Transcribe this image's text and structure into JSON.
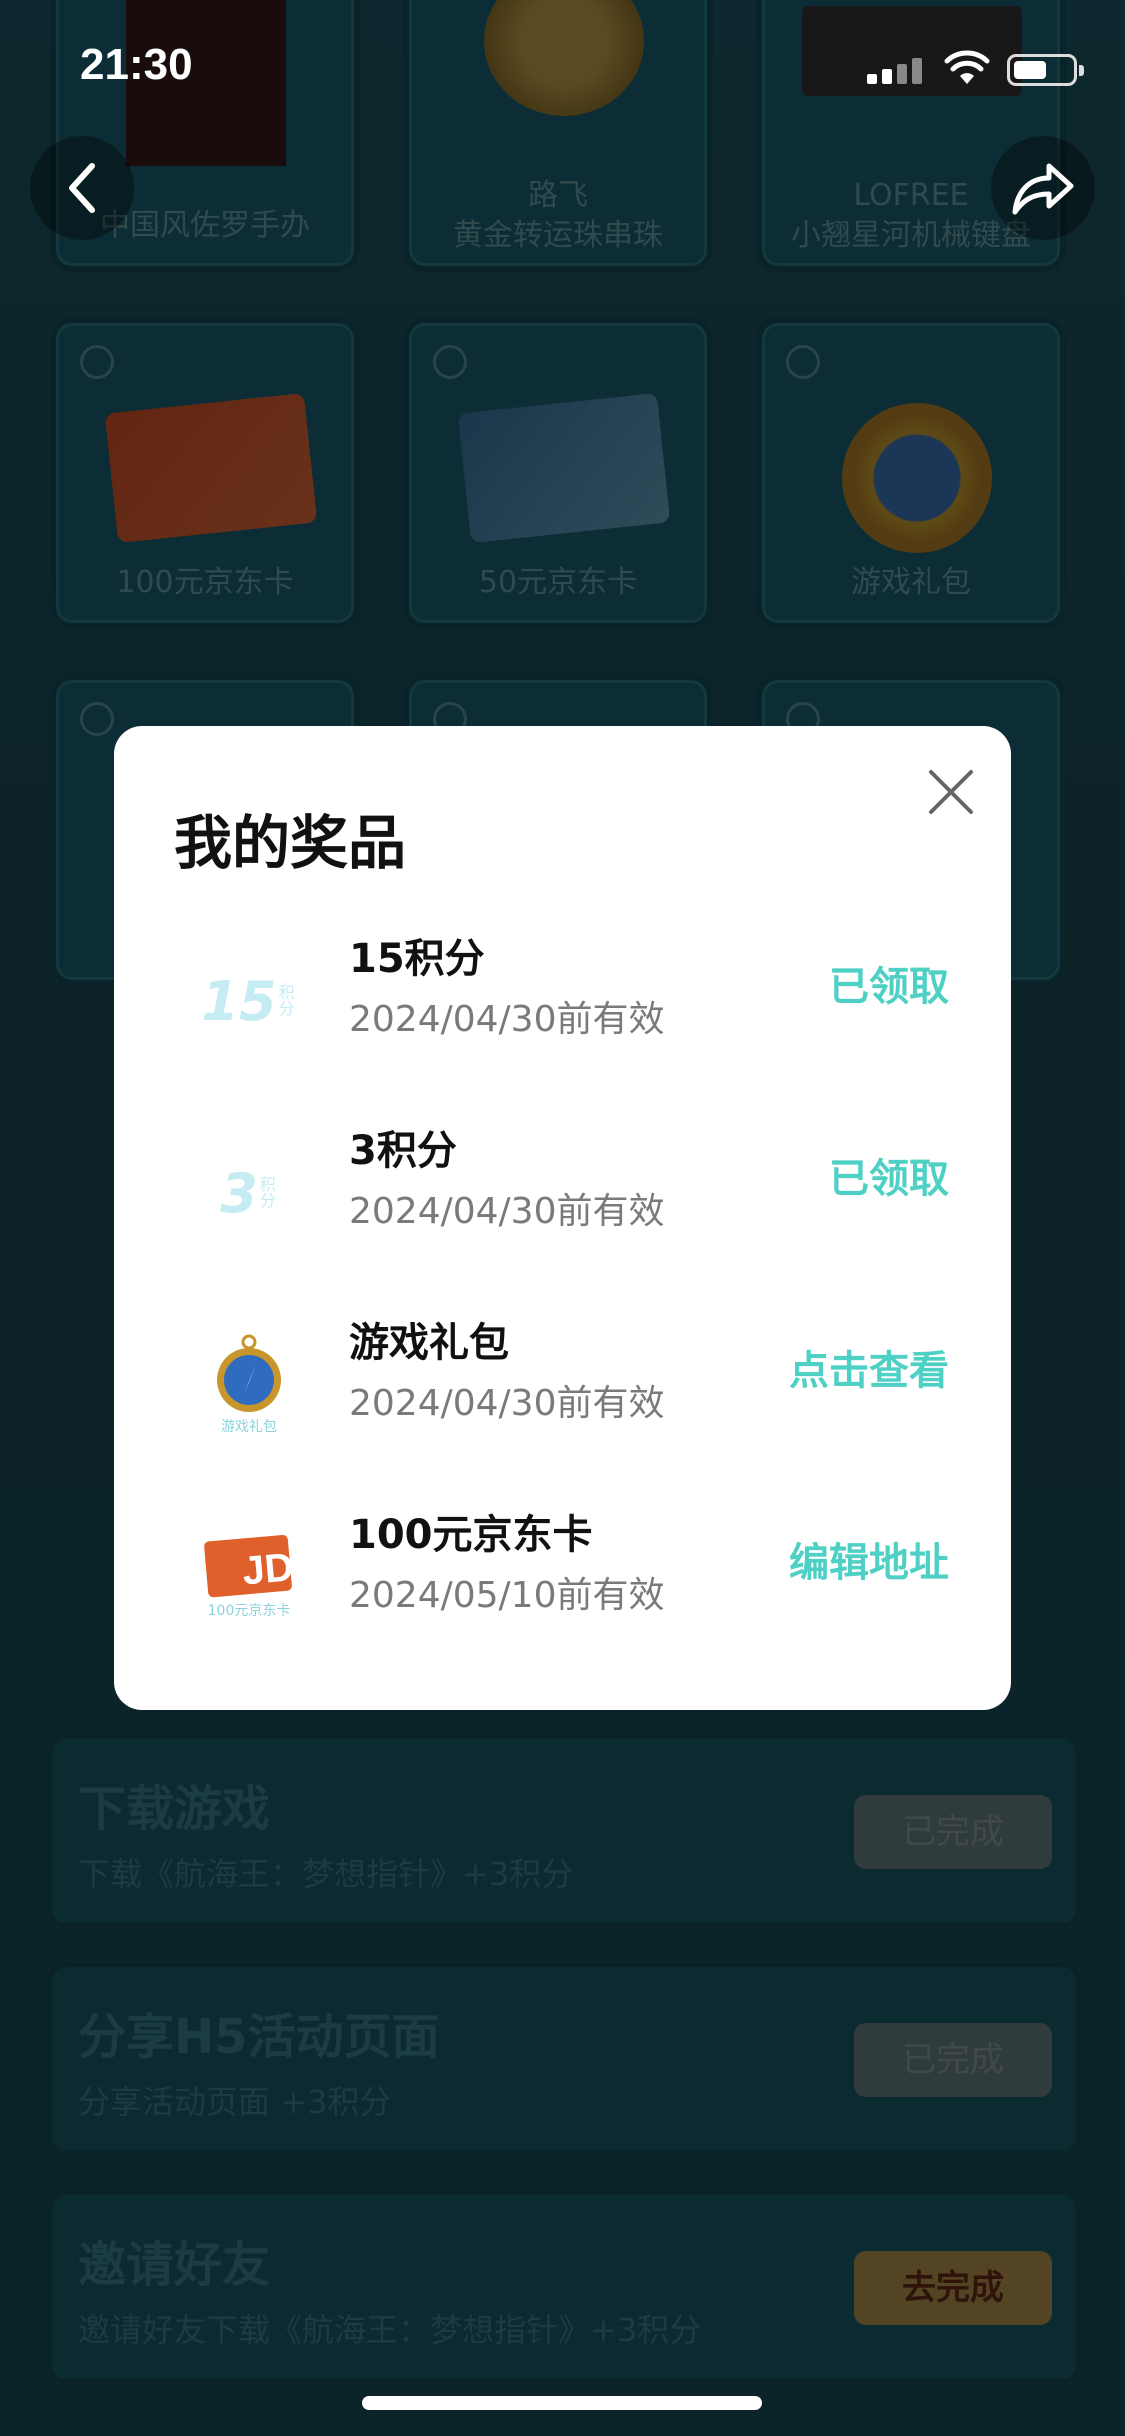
{
  "status_bar": {
    "time": "21:30"
  },
  "background": {
    "prizes": [
      {
        "label": "中国风佐罗手办",
        "art": "dark"
      },
      {
        "label": "路飞\n黄金转运珠串珠",
        "art": "figure"
      },
      {
        "label": "LOFREE\n小翘星河机械键盘",
        "art": "keyboard"
      },
      {
        "label": "100元京东卡",
        "art": "jd-orange"
      },
      {
        "label": "50元京东卡",
        "art": "jd-blue"
      },
      {
        "label": "游戏礼包",
        "art": "gift"
      },
      {
        "label": "",
        "art": ""
      },
      {
        "label": "",
        "art": ""
      },
      {
        "label": "",
        "art": ""
      }
    ],
    "tasks": [
      {
        "title": "下载游戏",
        "desc": "下载《航海王：梦想指针》+3积分",
        "button": "已完成",
        "done": true
      },
      {
        "title": "分享H5活动页面",
        "desc": "分享活动页面 +3积分",
        "button": "已完成",
        "done": true
      },
      {
        "title": "邀请好友",
        "desc": "邀请好友下载《航海王：梦想指针》+3积分",
        "button": "去完成",
        "done": false
      }
    ]
  },
  "modal": {
    "title": "我的奖品",
    "items": [
      {
        "name": "15积分",
        "date": "2024/04/30前有效",
        "action": "已领取",
        "thumb": "points-15",
        "thumb_text": "15",
        "thumb_unit": "积分"
      },
      {
        "name": "3积分",
        "date": "2024/04/30前有效",
        "action": "已领取",
        "thumb": "points-3",
        "thumb_text": "3",
        "thumb_unit": "积分"
      },
      {
        "name": "游戏礼包",
        "date": "2024/04/30前有效",
        "action": "点击查看",
        "thumb": "gift",
        "thumb_caption": "游戏礼包"
      },
      {
        "name": "100元京东卡",
        "date": "2024/05/10前有效",
        "action": "编辑地址",
        "thumb": "jd-card",
        "thumb_caption": "100元京东卡"
      }
    ]
  },
  "colors": {
    "accent": "#4fd0c4",
    "overlay": "rgba(0,0,0,0.55)"
  }
}
